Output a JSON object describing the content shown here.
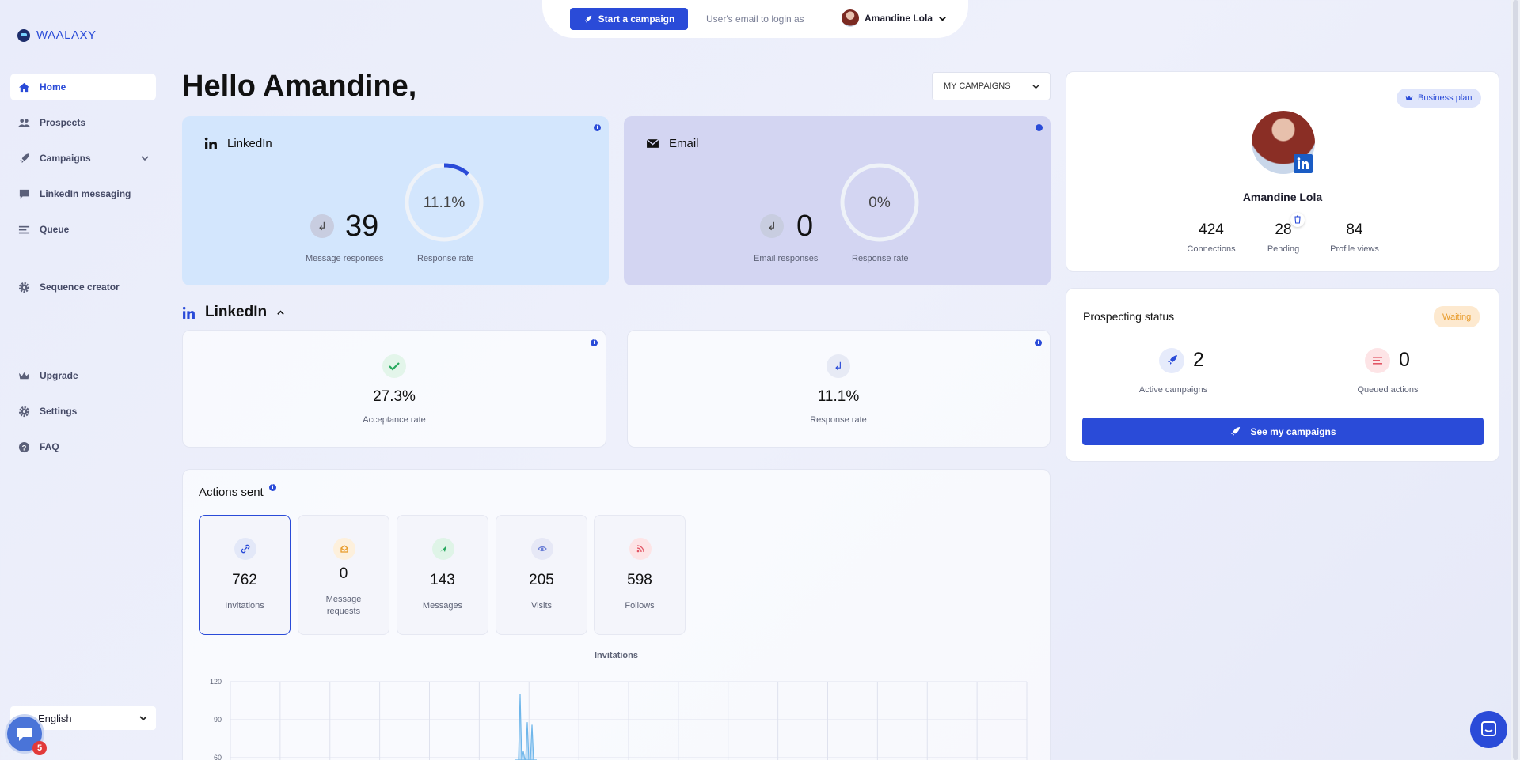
{
  "app": {
    "logo_text": "WAALAXY"
  },
  "sidebar": {
    "items": [
      {
        "label": "Home",
        "icon": "home-icon"
      },
      {
        "label": "Prospects",
        "icon": "users-icon"
      },
      {
        "label": "Campaigns",
        "icon": "rocket-icon"
      },
      {
        "label": "LinkedIn messaging",
        "icon": "chat-icon"
      },
      {
        "label": "Queue",
        "icon": "queue-icon"
      },
      {
        "label": "Sequence creator",
        "icon": "gear-icon"
      },
      {
        "label": "Upgrade",
        "icon": "crown-icon"
      },
      {
        "label": "Settings",
        "icon": "gear-icon"
      },
      {
        "label": "FAQ",
        "icon": "question-icon"
      }
    ],
    "language": "English",
    "chat_badge": "5"
  },
  "topbar": {
    "start_campaign": "Start a campaign",
    "login_as": "User's email to login as",
    "user_name": "Amandine Lola"
  },
  "main": {
    "greeting": "Hello Amandine,",
    "campaign_filter": "MY CAMPAIGNS",
    "linkedin_card": {
      "title": "LinkedIn",
      "responses": "39",
      "responses_label": "Message responses",
      "rate": "11.1%",
      "rate_label": "Response rate",
      "rate_value": 0.111
    },
    "email_card": {
      "title": "Email",
      "responses": "0",
      "responses_label": "Email responses",
      "rate": "0%",
      "rate_label": "Response rate",
      "rate_value": 0
    },
    "linkedin_section": {
      "title": "LinkedIn",
      "acceptance_rate": "27.3%",
      "acceptance_label": "Acceptance rate",
      "response_rate": "11.1%",
      "response_label": "Response rate"
    },
    "actions": {
      "title": "Actions sent",
      "tiles": [
        {
          "value": "762",
          "label": "Invitations"
        },
        {
          "value": "0",
          "label": "Message requests"
        },
        {
          "value": "143",
          "label": "Messages"
        },
        {
          "value": "205",
          "label": "Visits"
        },
        {
          "value": "598",
          "label": "Follows"
        }
      ]
    }
  },
  "profile": {
    "plan": "Business plan",
    "name": "Amandine Lola",
    "connections": "424",
    "connections_label": "Connections",
    "pending": "28",
    "pending_label": "Pending",
    "profile_views": "84",
    "profile_views_label": "Profile views"
  },
  "prospecting": {
    "title": "Prospecting status",
    "status": "Waiting",
    "active_campaigns": "2",
    "active_campaigns_label": "Active campaigns",
    "queued_actions": "0",
    "queued_actions_label": "Queued actions",
    "button": "See my campaigns"
  },
  "colors": {
    "accent": "#2a4bd8",
    "linkedin_card_bg": "#d3e6fd",
    "email_card_bg": "#d3d5f2"
  },
  "chart_data": {
    "type": "line",
    "title": "Invitations",
    "yticks": [
      120,
      90,
      60
    ],
    "ylim": [
      60,
      120
    ],
    "series": [
      {
        "values": [
          110,
          65,
          88,
          86
        ]
      }
    ]
  }
}
